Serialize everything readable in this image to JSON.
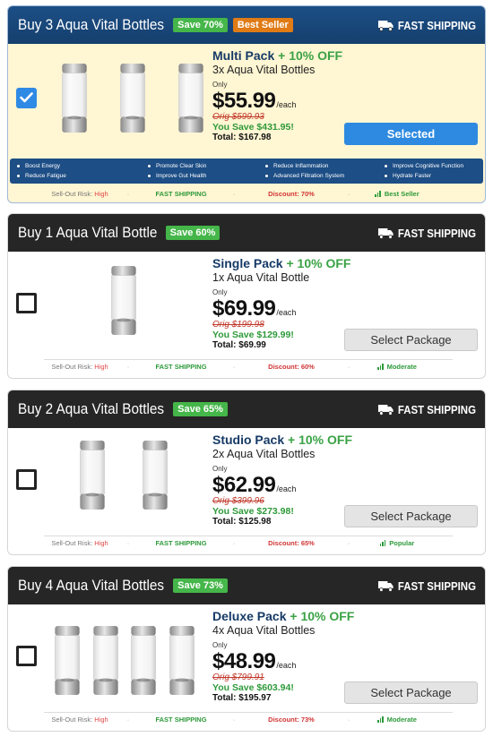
{
  "shipping_label": "FAST SHIPPING",
  "only_label": "Only",
  "each_label": "/each",
  "risk_label": "Sell-Out Risk:",
  "colors": {
    "header_selected": "#1c4f86",
    "header_plain": "#262626",
    "save_badge": "#45b649",
    "best_badge": "#e07b16",
    "select_active": "#2e8ae0",
    "offer_green": "#3aa245"
  },
  "packages": [
    {
      "header_title": "Buy 3 Aqua Vital Bottles",
      "save_badge": "Save 70%",
      "extra_badge": "Best Seller",
      "pack_name": "Multi Pack",
      "offer": "+ 10% OFF",
      "quantity": "3x Aqua Vital Bottles",
      "price": "$55.99",
      "orig_price": "Orig $599.93",
      "you_save": "You Save $431.95!",
      "total": "Total: $167.98",
      "button": "Selected",
      "selected": true,
      "bottle_count": 3,
      "benefits": [
        "Boost Energy",
        "Promote Clear Skin",
        "Reduce Inflammation",
        "Improve Cognitive Function",
        "Reduce Fatigue",
        "Improve Gut Health",
        "Advanced Filtration System",
        "Hydrate Faster"
      ],
      "risk_level": "High",
      "discount": "Discount: 70%",
      "popularity": "Best Seller"
    },
    {
      "header_title": "Buy 1 Aqua Vital Bottle",
      "save_badge": "Save 60%",
      "pack_name": "Single Pack",
      "offer": "+ 10% OFF",
      "quantity": "1x Aqua Vital Bottle",
      "price": "$69.99",
      "orig_price": "Orig $199.98",
      "you_save": "You Save $129.99!",
      "total": "Total: $69.99",
      "button": "Select Package",
      "selected": false,
      "bottle_count": 1,
      "risk_level": "High",
      "discount": "Discount: 60%",
      "popularity": "Moderate"
    },
    {
      "header_title": "Buy 2 Aqua Vital Bottles",
      "save_badge": "Save 65%",
      "pack_name": "Studio Pack",
      "offer": "+ 10% OFF",
      "quantity": "2x Aqua Vital Bottles",
      "price": "$62.99",
      "orig_price": "Orig $399.96",
      "you_save": "You Save $273.98!",
      "total": "Total: $125.98",
      "button": "Select Package",
      "selected": false,
      "bottle_count": 2,
      "risk_level": "High",
      "discount": "Discount: 65%",
      "popularity": "Popular"
    },
    {
      "header_title": "Buy 4 Aqua Vital Bottles",
      "save_badge": "Save 73%",
      "pack_name": "Deluxe Pack",
      "offer": "+ 10% OFF",
      "quantity": "4x Aqua Vital Bottles",
      "price": "$48.99",
      "orig_price": "Orig $799.91",
      "you_save": "You Save $603.94!",
      "total": "Total: $195.97",
      "button": "Select Package",
      "selected": false,
      "bottle_count": 4,
      "risk_level": "High",
      "discount": "Discount: 73%",
      "popularity": "Moderate"
    }
  ]
}
